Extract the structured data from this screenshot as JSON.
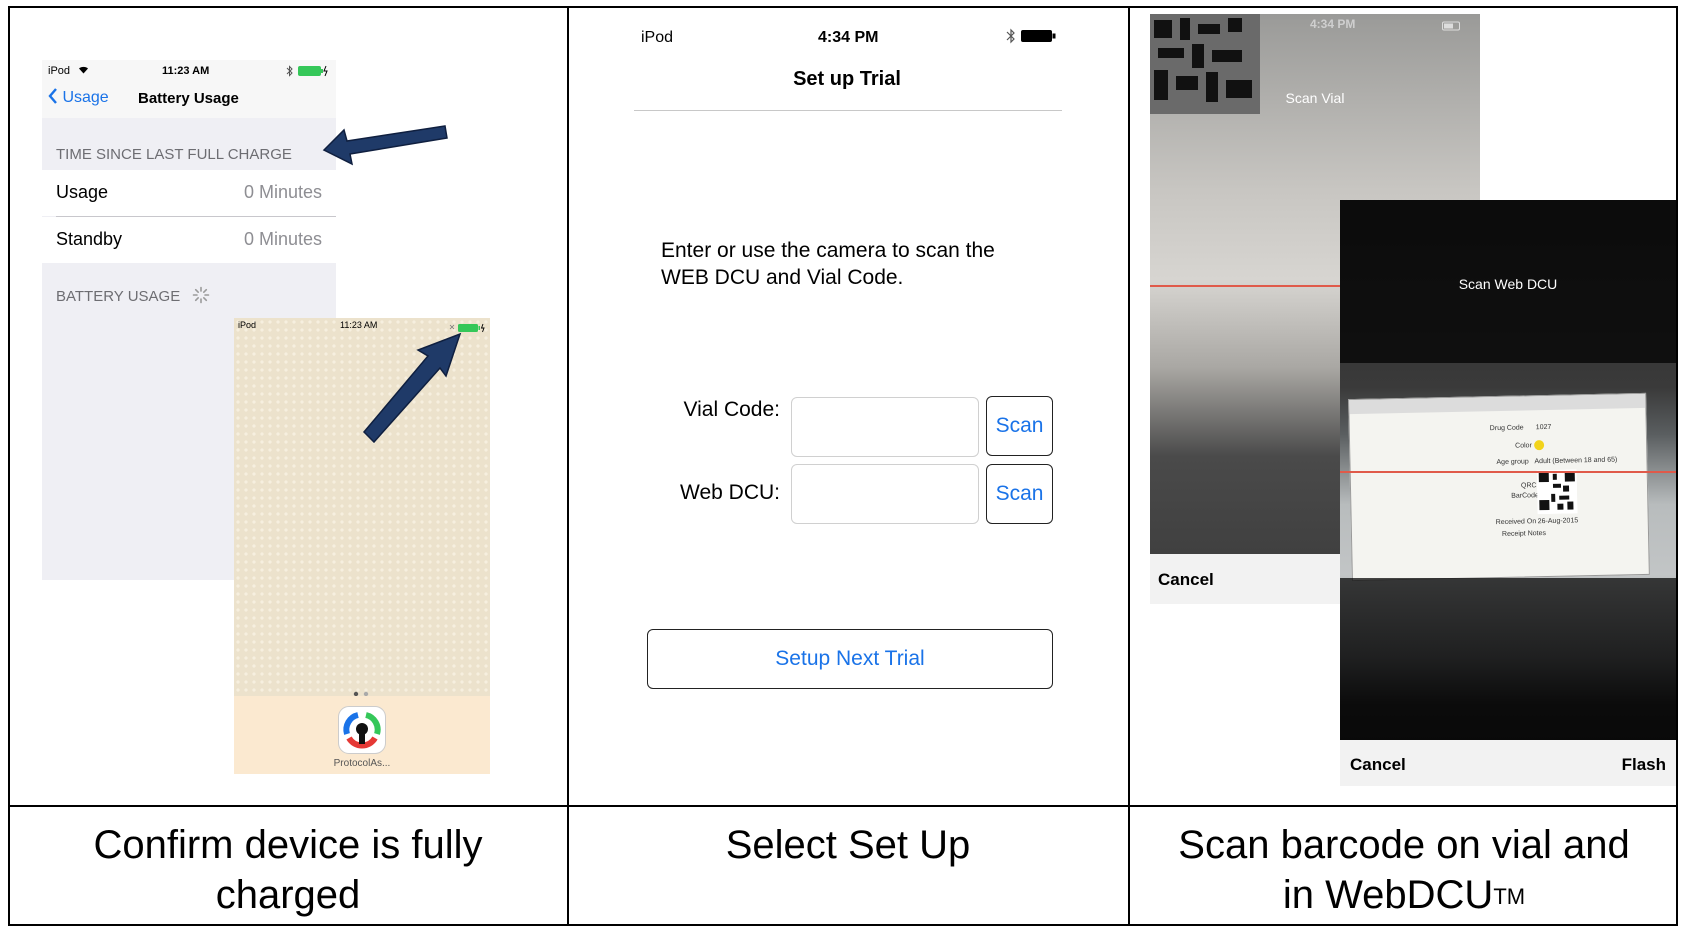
{
  "captions": {
    "col1_line1": "Confirm device is fully",
    "col1_line2": "charged",
    "col2_line1": "Select Set Up",
    "col3_line1": "Scan barcode on vial and",
    "col3_line2": "in WebDCU",
    "col3_sup": "TM"
  },
  "battery_screen": {
    "status_carrier": "iPod",
    "status_time": "11:23 AM",
    "back_label": "Usage",
    "title": "Battery Usage",
    "section1": "TIME SINCE LAST FULL CHARGE",
    "rows": [
      {
        "label": "Usage",
        "value": "0 Minutes"
      },
      {
        "label": "Standby",
        "value": "0 Minutes"
      }
    ],
    "section2": "BATTERY USAGE"
  },
  "home_screen": {
    "status_carrier": "iPod",
    "status_time": "11:23 AM",
    "app_label": "ProtocolAs..."
  },
  "setup_screen": {
    "status_carrier": "iPod",
    "status_time": "4:34 PM",
    "title": "Set up Trial",
    "instruction_line1": "Enter or use the camera to scan the",
    "instruction_line2": "WEB DCU and Vial Code.",
    "vial_label": "Vial Code:",
    "webdcu_label": "Web DCU:",
    "scan_label": "Scan",
    "setup_next_label": "Setup Next Trial"
  },
  "scan_vial": {
    "status_time": "4:34 PM",
    "title": "Scan Vial",
    "cancel_label": "Cancel"
  },
  "scan_webdcu": {
    "title": "Scan Web DCU",
    "cancel_label": "Cancel",
    "flash_label": "Flash",
    "form": {
      "drug_code_label": "Drug Code",
      "drug_code_value": "1027",
      "color_label": "Color",
      "age_group_label": "Age group",
      "age_group_value": "Adult (Between 18 and 65)",
      "qr_label": "QRC",
      "barcode_label": "BarCode",
      "received_label": "Received On",
      "received_value": "26-Aug-2015",
      "receipt_label": "Receipt Notes"
    }
  },
  "colors": {
    "ios_blue": "#1a73e8",
    "battery_green": "#35c759",
    "arrow_blue": "#1f3a68"
  }
}
